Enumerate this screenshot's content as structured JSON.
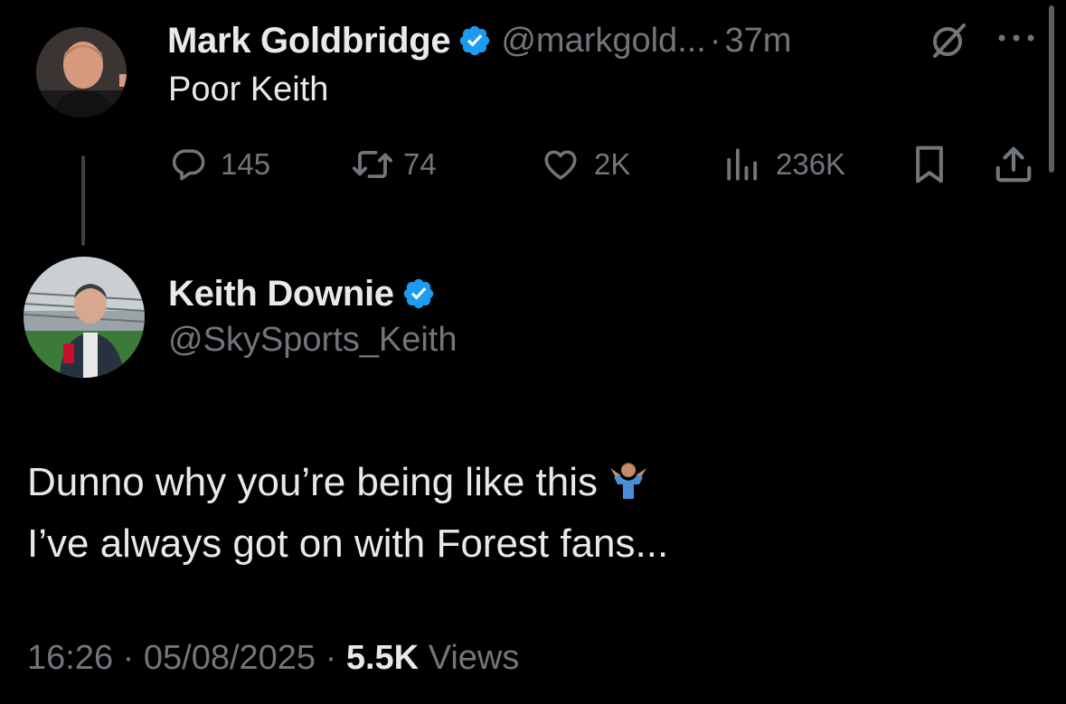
{
  "tweet": {
    "author_name": "Mark Goldbridge",
    "author_handle": "@markgold...",
    "separator": "·",
    "time_ago": "37m",
    "text": "Poor Keith",
    "reply_count": "145",
    "retweet_count": "74",
    "like_count": "2K",
    "view_count": "236K"
  },
  "reply": {
    "author_name": "Keith Downie",
    "author_handle": "@SkySports_Keith",
    "text_line1": "Dunno why you’re being like this",
    "text_line2": "I’ve always got on with Forest fans...",
    "time": "16:26",
    "separator": "·",
    "date": "05/08/2025",
    "views_count": "5.5K",
    "views_label": "Views"
  },
  "colors": {
    "background": "#000000",
    "primary_text": "#e7e9ea",
    "secondary_text": "#71767b",
    "verified_blue": "#1d9bf0"
  },
  "icons": [
    "verified-icon",
    "grok-icon",
    "more-icon",
    "reply-icon",
    "retweet-icon",
    "like-icon",
    "views-icon",
    "bookmark-icon",
    "share-icon",
    "shrug-emoji"
  ]
}
